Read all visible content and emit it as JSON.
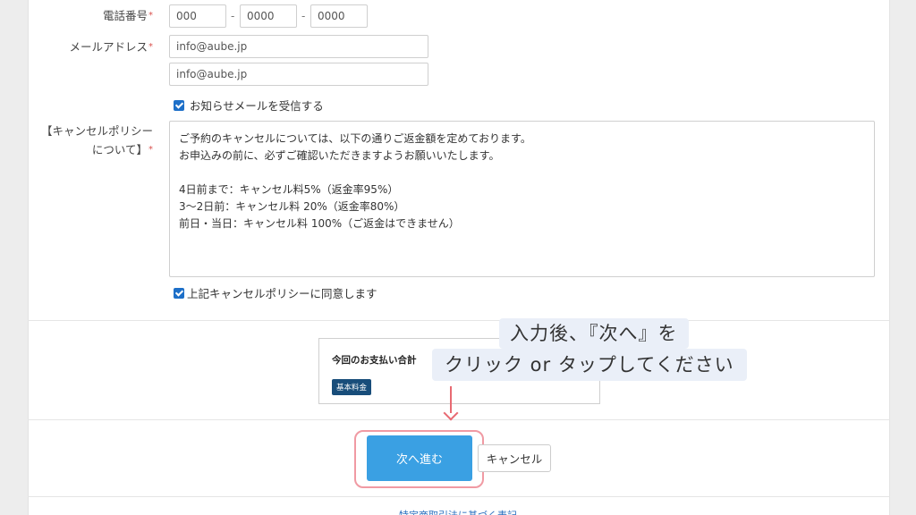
{
  "form": {
    "phone": {
      "label": "電話番号",
      "required_mark": "*",
      "part1": "000",
      "part2": "0000",
      "part3": "0000",
      "separator": "-"
    },
    "email": {
      "label": "メールアドレス",
      "required_mark": "*",
      "value": "info@aube.jp",
      "confirm_value": "info@aube.jp"
    },
    "newsletter": {
      "label": "お知らせメールを受信する",
      "checked": true
    },
    "policy": {
      "label_line1": "【キャンセルポリシー",
      "label_line2": "について】",
      "required_mark": "*",
      "lines": [
        "ご予約のキャンセルについては、以下の通りご返金額を定めております。",
        "お申込みの前に、必ずご確認いただきますようお願いいたします。",
        "",
        "4日前まで：キャンセル料5%（返金率95%）",
        "3〜2日前：キャンセル料 20%（返金率80%）",
        "前日・当日：キャンセル料 100%（ご返金はできません）"
      ],
      "agree_label": "上記キャンセルポリシーに同意します",
      "agree_checked": true
    }
  },
  "summary": {
    "title": "今回のお支払い合計",
    "badge": "基本料金"
  },
  "annotation": {
    "line1": "入力後、『次へ』を",
    "line2": "クリック or タップしてください",
    "accent": "#e86a72"
  },
  "buttons": {
    "next": "次へ進む",
    "cancel": "キャンセル"
  },
  "footer": {
    "link": "特定商取引法に基づく表記"
  },
  "colors": {
    "primary": "#3aa0e3",
    "checkbox": "#1d6fc8",
    "badge": "#184d7a",
    "highlight": "#f09aa3"
  }
}
